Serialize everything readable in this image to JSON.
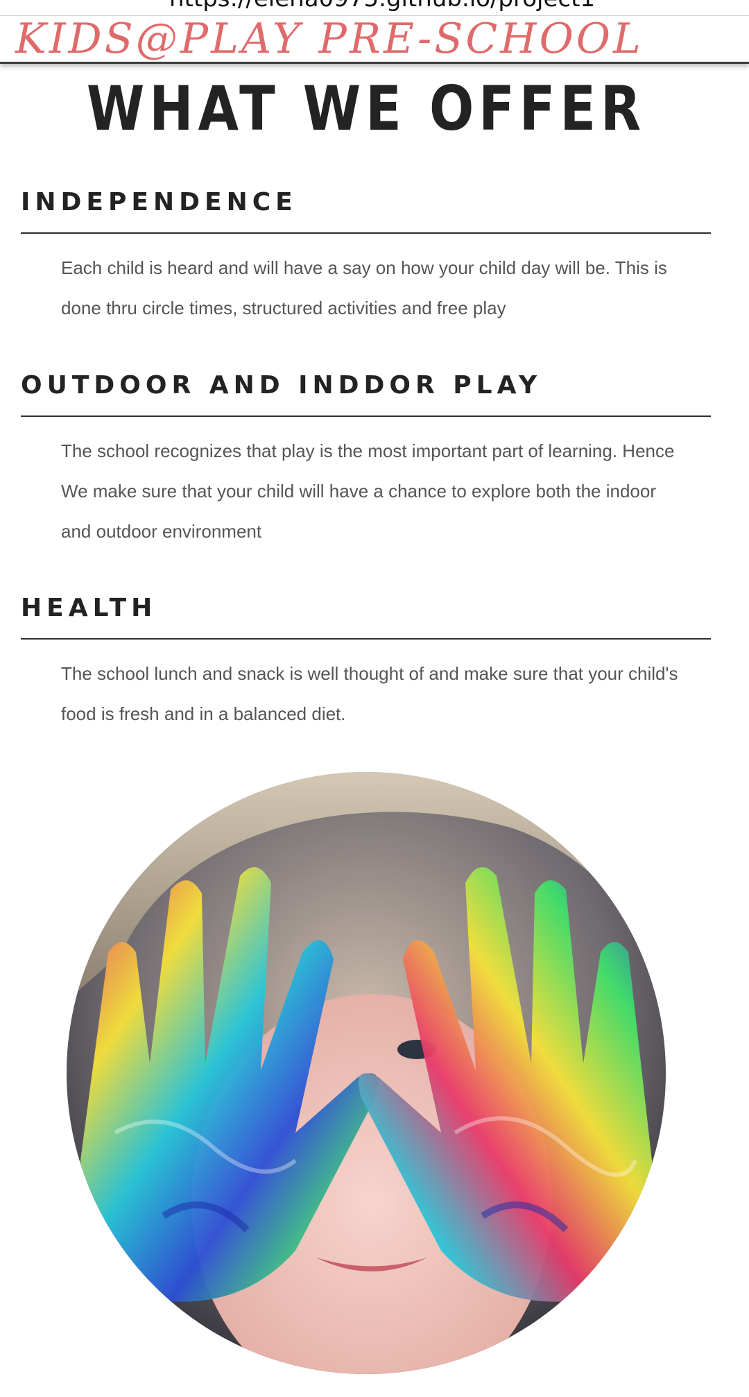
{
  "browser": {
    "url": "https://elena0975.github.io/project1"
  },
  "navbar": {
    "brand": "KIDS@PLAY PRE-SCHOOL"
  },
  "main": {
    "title": "WHAT WE OFFER",
    "sections": [
      {
        "heading": "INDEPENDENCE",
        "body": "Each child is heard and will have a say on how your child day will be. This is done thru circle times, structured activities and free play"
      },
      {
        "heading": "OUTDOOR AND INDDOR PLAY",
        "body": "The school recognizes that play is the most important part of learning. Hence We make sure that your child will have a chance to explore both the indoor and outdoor environment"
      },
      {
        "heading": "HEALTH",
        "body": "The school lunch and snack is well thought of and make sure that your child's food is fresh and in a balanced diet."
      }
    ],
    "image": {
      "subject": "child-with-painted-hands"
    }
  },
  "colors": {
    "brand": "#e06a6a",
    "heading": "#232323",
    "body_text": "#555555",
    "rule": "#2e2e2e"
  }
}
